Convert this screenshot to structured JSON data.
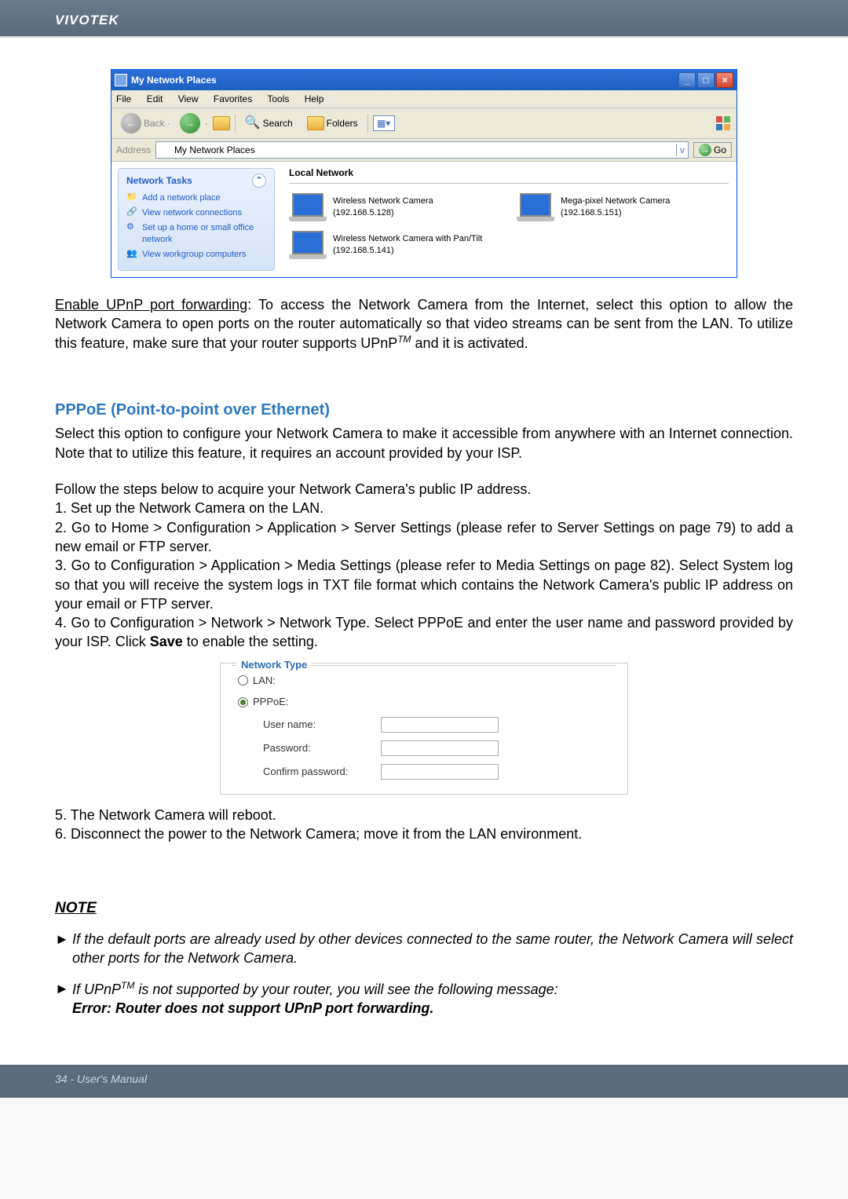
{
  "header": {
    "brand": "VIVOTEK"
  },
  "win": {
    "title": "My Network Places",
    "minimize": "_",
    "maximize": "□",
    "close": "×",
    "menu": {
      "file": "File",
      "edit": "Edit",
      "view": "View",
      "favorites": "Favorites",
      "tools": "Tools",
      "help": "Help"
    },
    "toolbar": {
      "back": "Back",
      "search": "Search",
      "folders": "Folders"
    },
    "address_label": "Address",
    "address_value": "My Network Places",
    "go": "Go",
    "side_head": "Network Tasks",
    "tasks": {
      "add": "Add a network place",
      "view_conn": "View network connections",
      "setup": "Set up a home or small office network",
      "view_wg": "View workgroup computers"
    },
    "local_net": "Local Network",
    "devs": {
      "a": "Wireless Network Camera (192.168.5.128)",
      "b": "Mega-pixel Network Camera (192.168.5.151)",
      "c": "Wireless Network Camera with Pan/Tilt (192.168.5.141)"
    }
  },
  "body": {
    "upnp_lead": "Enable UPnP port forwarding",
    "upnp_rest": ": To access the Network Camera from the Internet, select this option to allow the Network Camera to open ports on the router automatically so that video streams can be sent from the LAN. To utilize this feature, make sure that your router supports UPnP",
    "upnp_tail": " and it is activated.",
    "tm": "TM"
  },
  "pppoe": {
    "head": "PPPoE (Point-to-point over Ethernet)",
    "p1": "Select this option to configure your Network Camera to make it accessible from anywhere with an Internet connection. Note that to utilize this feature, it requires an account provided by your ISP.",
    "p2": "Follow the steps below to acquire your Network Camera's public IP address.",
    "s1": "1. Set up the Network Camera on the LAN.",
    "s2": "2. Go to Home > Configuration > Application > Server Settings (please refer to Server Settings on page 79) to add a new email or FTP server.",
    "s3": "3. Go to Configuration > Application > Media Settings (please refer to Media Settings on page 82). Select System log so that you will receive the system logs in TXT file format which contains the Network Camera's public IP address on your email or FTP server.",
    "s4a": "4. Go to Configuration > Network > Network Type. Select PPPoE and enter the user name and password provided by your ISP. Click ",
    "s4b": "Save",
    "s4c": " to enable the setting.",
    "s5": "5. The Network Camera will reboot.",
    "s6": "6. Disconnect the power to the Network Camera; move it from the LAN environment."
  },
  "form": {
    "legend": "Network Type",
    "lan": "LAN:",
    "pppoe": "PPPoE:",
    "user": "User name:",
    "pass": "Password:",
    "confirm": "Confirm password:"
  },
  "note": {
    "head": "NOTE",
    "n1": "If the default ports are already used by other devices connected to the same router, the Network Camera will select other ports for the Network Camera.",
    "n2a": "If UPnP",
    "n2b": " is not supported by your router, you will see the following message:",
    "err": "Error: Router does not support UPnP port forwarding.",
    "arrow": "►"
  },
  "footer": {
    "text": "34 - User's Manual"
  }
}
